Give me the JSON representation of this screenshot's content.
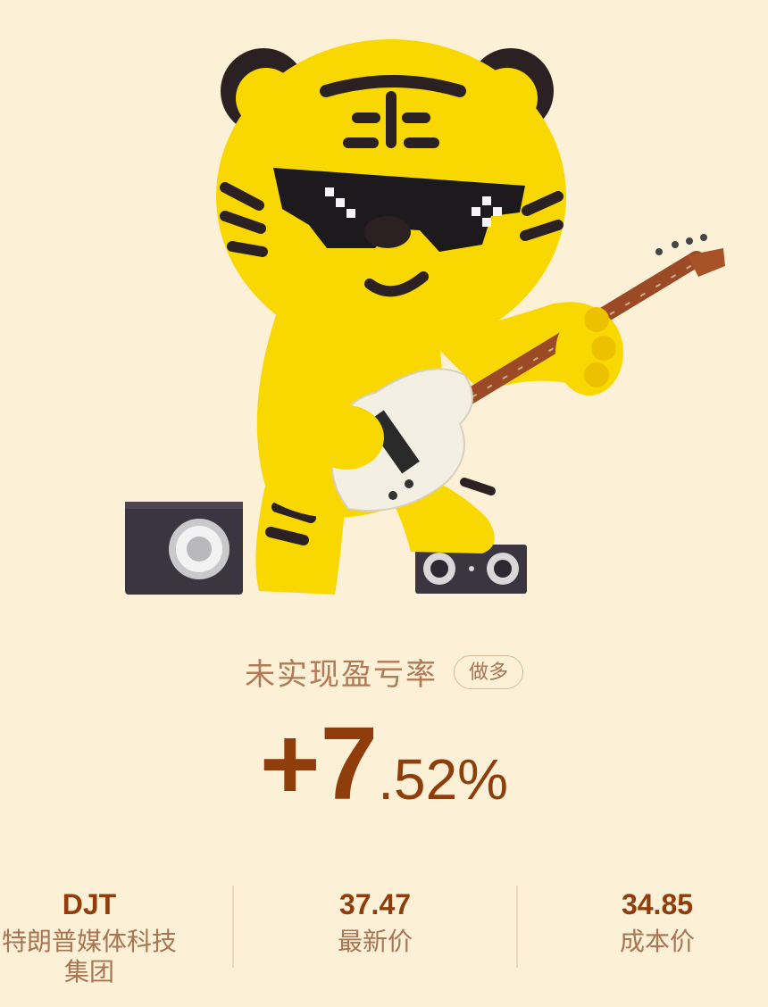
{
  "position": {
    "title": "未实现盈亏率",
    "direction_badge": "做多",
    "pnl_integer": "+7",
    "pnl_decimal": ".52%"
  },
  "stats": [
    {
      "value": "DJT",
      "label_line1": "特朗普媒体科技",
      "label_line2": "集团"
    },
    {
      "value": "37.47",
      "label_line1": "最新价"
    },
    {
      "value": "34.85",
      "label_line1": "成本价"
    }
  ],
  "colors": {
    "background": "#fcf0d6",
    "accent": "#8f3d0b",
    "muted": "#a87452",
    "mascot": "#f9d700"
  }
}
